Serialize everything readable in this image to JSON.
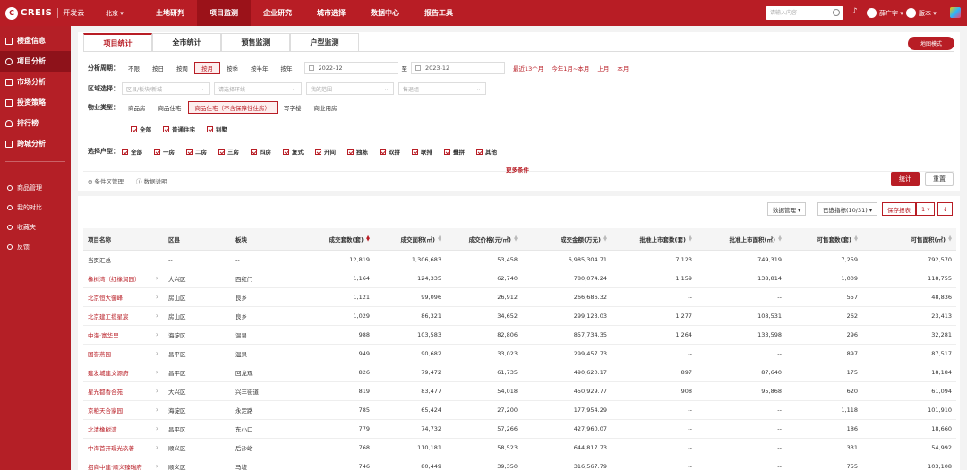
{
  "header": {
    "logo_mark": "C",
    "logo_text": "CREIS",
    "logo_sub": "开发云",
    "city": "北京 ▾",
    "nav": [
      "土地研判",
      "项目监测",
      "企业研究",
      "城市选择",
      "数据中心",
      "报告工具"
    ],
    "search_placeholder": "请输入内容",
    "user": "薛广宇 ▾",
    "version": "版本 ▾"
  },
  "sidebar": {
    "main": [
      "楼盘信息",
      "项目分析",
      "市场分析",
      "投资策略",
      "排行榜",
      "跨城分析"
    ],
    "sub": [
      "商品管理",
      "我的对比",
      "收藏夹",
      "反馈"
    ]
  },
  "filters": {
    "tabs": [
      "项目统计",
      "全市统计",
      "预售监测",
      "户型监测"
    ],
    "map_button": "地图模式",
    "period_label": "分析周期：",
    "period_options": [
      "不限",
      "按日",
      "按周",
      "按月",
      "按季",
      "按半年",
      "按年"
    ],
    "date_from": "2022-12",
    "date_to": "2023-12",
    "to_text": "至",
    "quick_ranges": [
      "最近13个月",
      "今年1月~本月",
      "上月",
      "本月"
    ],
    "area_label": "区域选择：",
    "area_selects": [
      "区县/板块/新城",
      "请选择环线",
      "我的范围",
      "售退组"
    ],
    "property_label": "物业类型：",
    "property_options": [
      "商品房",
      "商品住宅",
      "商品住宅（不含保障性住房）",
      "写字楼",
      "商业用房"
    ],
    "property_checks": [
      "全部",
      "普通住宅",
      "别墅"
    ],
    "unit_label": "选择户型：",
    "unit_checks": [
      "全部",
      "一房",
      "二房",
      "三房",
      "四房",
      "复式",
      "开间",
      "独栋",
      "双拼",
      "联排",
      "叠拼",
      "其他"
    ],
    "more_conditions": "更多条件",
    "links": [
      "⊕ 条件区管理",
      "ⓘ 数据说明"
    ],
    "stat_button": "统计",
    "reset_button": "重置"
  },
  "toolbar": {
    "data_manage": "数据管理 ▾",
    "indicators": "已选指标(10/31) ▾",
    "save_report": "保存报表",
    "page_num": "1 ▾",
    "download": "↓"
  },
  "table": {
    "headers": [
      "项目名称",
      "区县",
      "板块",
      "成交套数(套)",
      "成交面积(㎡)",
      "成交价格(元/㎡)",
      "成交金额(万元)",
      "批准上市套数(套)",
      "批准上市面积(㎡)",
      "可售套数(套)",
      "可售面积(㎡)"
    ],
    "rows": [
      [
        "当页汇总",
        "--",
        "--",
        "12,819",
        "1,306,683",
        "53,458",
        "6,985,304.71",
        "7,123",
        "749,319",
        "7,259",
        "792,570"
      ],
      [
        "橡树湾（红橡润园）",
        "大兴区",
        "西红门",
        "1,164",
        "124,335",
        "62,740",
        "780,074.24",
        "1,159",
        "138,814",
        "1,009",
        "118,755"
      ],
      [
        "北京恒大御峰",
        "房山区",
        "良乡",
        "1,121",
        "99,096",
        "26,912",
        "266,686.32",
        "--",
        "--",
        "557",
        "48,836"
      ],
      [
        "北京建工揽星宸",
        "房山区",
        "良乡",
        "1,029",
        "86,321",
        "34,652",
        "299,123.03",
        "1,277",
        "108,531",
        "262",
        "23,413"
      ],
      [
        "中海·富华里",
        "海淀区",
        "温泉",
        "988",
        "103,583",
        "82,806",
        "857,734.35",
        "1,264",
        "133,598",
        "296",
        "32,281"
      ],
      [
        "国誉燕园",
        "昌平区",
        "温泉",
        "949",
        "90,682",
        "33,023",
        "299,457.73",
        "--",
        "--",
        "897",
        "87,517"
      ],
      [
        "建发城建文源府",
        "昌平区",
        "回龙观",
        "826",
        "79,472",
        "61,735",
        "490,620.17",
        "897",
        "87,640",
        "175",
        "18,184"
      ],
      [
        "星光都香合苑",
        "大兴区",
        "兴丰街道",
        "819",
        "83,477",
        "54,018",
        "450,929.77",
        "908",
        "95,868",
        "620",
        "61,094"
      ],
      [
        "京粮天合家园",
        "海淀区",
        "永定路",
        "785",
        "65,424",
        "27,200",
        "177,954.29",
        "--",
        "--",
        "1,118",
        "101,910"
      ],
      [
        "北清橡树湾",
        "昌平区",
        "东小口",
        "779",
        "74,732",
        "57,266",
        "427,960.07",
        "--",
        "--",
        "186",
        "18,660"
      ],
      [
        "中海首开璟光玖著",
        "顺义区",
        "后沙峪",
        "768",
        "110,181",
        "58,523",
        "644,817.73",
        "--",
        "--",
        "331",
        "54,992"
      ],
      [
        "招商中建·顺义臻瑞府",
        "顺义区",
        "马坡",
        "746",
        "80,449",
        "39,350",
        "316,567.79",
        "--",
        "--",
        "755",
        "103,108"
      ]
    ]
  },
  "colors": {
    "brand": "#b81d25",
    "sidebar": "#b41f26"
  }
}
